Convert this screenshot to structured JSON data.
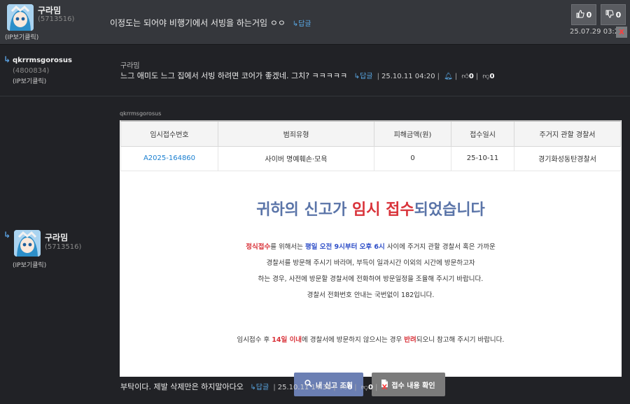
{
  "comment1": {
    "nickname": "구라밈",
    "user_id": "(5713516)",
    "ip_label": "(IP보기클릭)",
    "text": "이정도는 되어야 비행기에서 서빙을 하는거임 ㅇㅇ",
    "reply_label": "답글",
    "like_count": "0",
    "dislike_count": "0",
    "date": "25.07.29 03:23",
    "delete_label": "X"
  },
  "comment2": {
    "nickname": "qkrrmsgorosus",
    "user_id": "(4800834)",
    "ip_label": "(IP보기클릭)",
    "quote": "구라밈",
    "text": "느그 애미도 느그 집에서 서빙 하려면 코어가 좋겠네. 그치? ㅋㅋㅋㅋㅋ",
    "reply_label": "답글",
    "date": "25.10.11 04:20",
    "like_count": "0",
    "dislike_count": "0"
  },
  "comment3": {
    "nickname": "구라밈",
    "user_id": "(5713516)",
    "ip_label": "(IP보기클릭)",
    "tag": "qkrrmsgorosus",
    "table": {
      "headers": [
        "임시접수번호",
        "범죄유형",
        "피해금액(원)",
        "접수일시",
        "주거지 관할 경찰서"
      ],
      "row": [
        "A2025-164860",
        "사이버 명예훼손·모욕",
        "0",
        "25-10-11",
        "경기화성동탄경찰서"
      ]
    },
    "headline": {
      "part1": "귀하의 신고가 ",
      "part2": "임시 접수",
      "part3": "되었습니다"
    },
    "notice": {
      "l1_red": "정식접수",
      "l1_a": "를 위해서는 ",
      "l1_blue": "평일 오전 9시부터 오후 6시",
      "l1_b": " 사이에 주거지 관할 경찰서 혹은 가까운",
      "l2": "경찰서를 방문해 주시기 바라며, 부득이 일과시간 이외의 시간에 방문하고자",
      "l3": "하는 경우, 사전에 방문할 경찰서에 전화하여 방문일정을 조율해 주시기 바랍니다.",
      "l4": "경찰서 전화번호 안내는 국번없이 182입니다.",
      "l5_a": "임시접수 후 ",
      "l5_red1": "14일 이내",
      "l5_b": "에 경찰서에 방문하지 않으시는 경우 ",
      "l5_red2": "반려",
      "l5_c": "되오니 참고해 주시기 바랍니다."
    },
    "buttons": {
      "view_report": "내 신고 조회",
      "check_details": "접수 내용 확인"
    },
    "text": "부탁이다. 제발 삭제만은 하지말아다오",
    "reply_label": "답글",
    "date": "25.10.11 14:36",
    "like_count": "0",
    "dislike_count": "0",
    "delete_label": "X"
  },
  "colors": {
    "background": "#212226",
    "highlight_row": "#35373c",
    "accent_blue": "#5aa9e6",
    "alert_red": "#d9333a"
  }
}
